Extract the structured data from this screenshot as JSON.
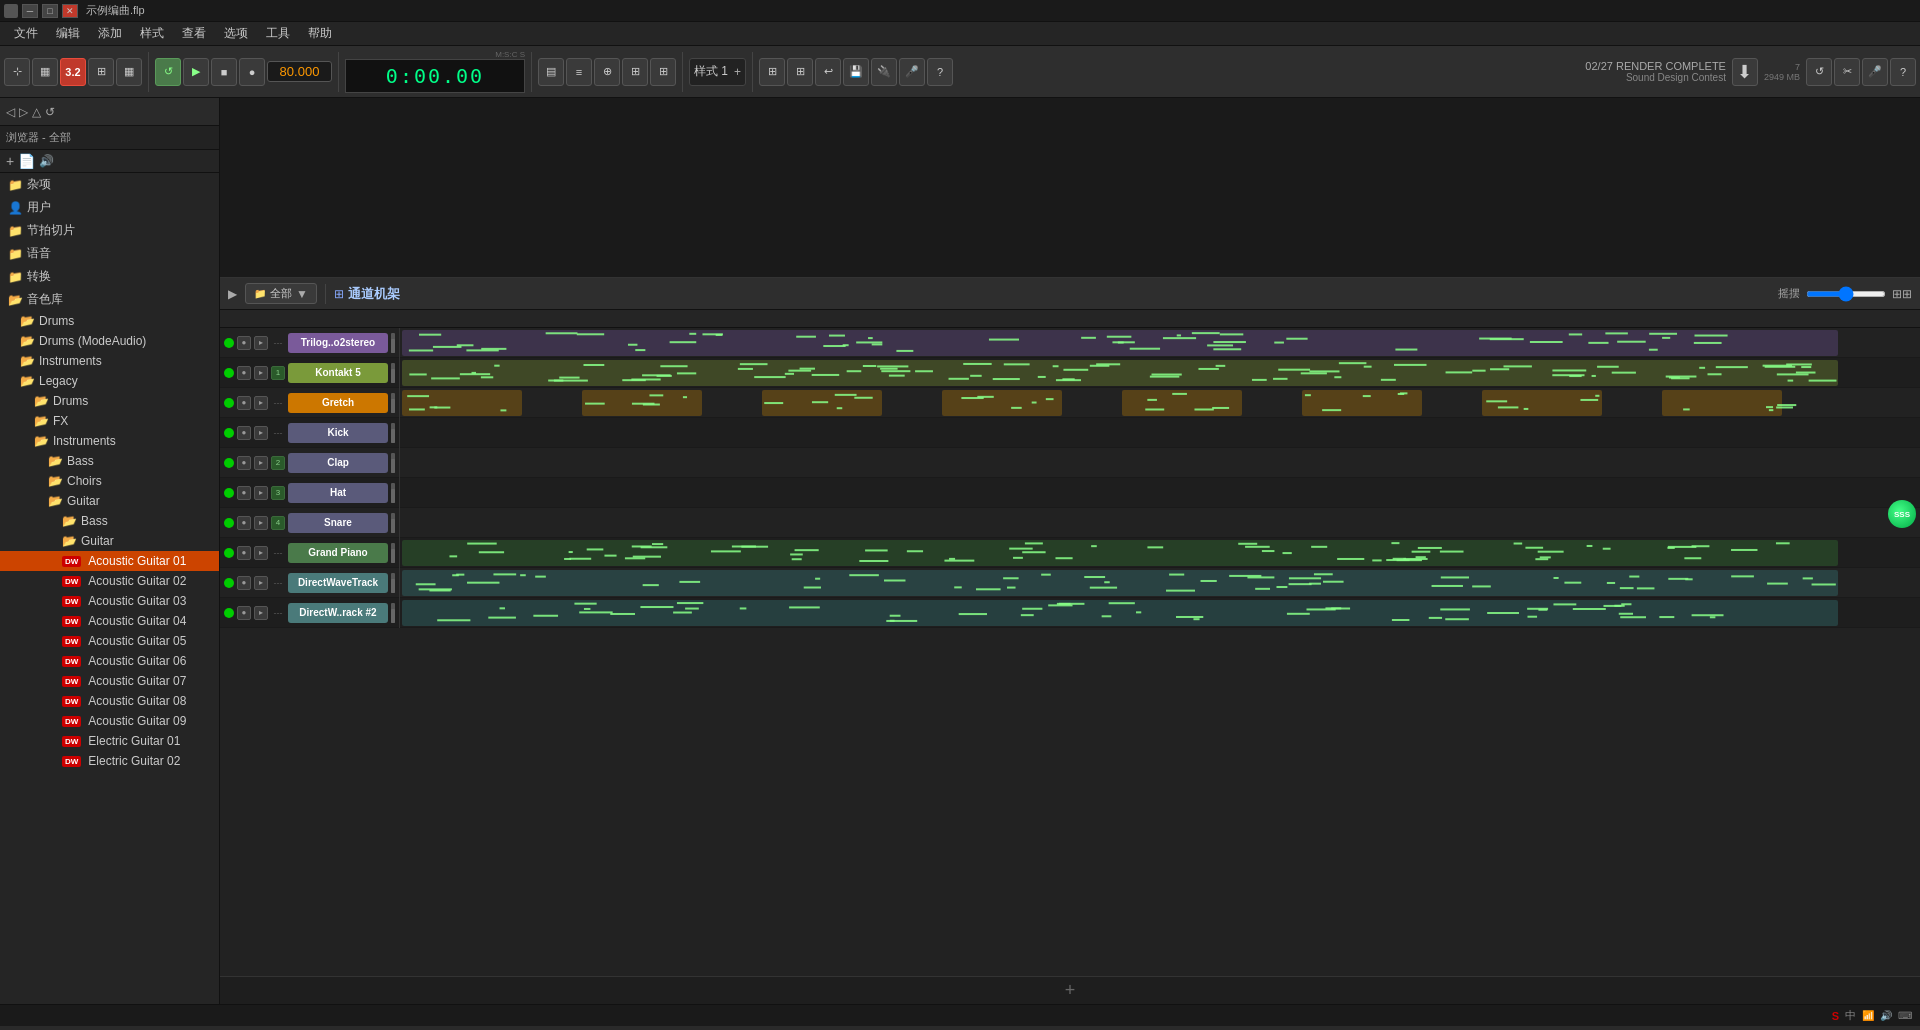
{
  "titlebar": {
    "icon": "●",
    "title": "示例编曲.flp",
    "minimize_label": "─",
    "maximize_label": "□",
    "close_label": "✕"
  },
  "menubar": {
    "items": [
      "文件",
      "编辑",
      "添加",
      "样式",
      "查看",
      "选项",
      "工具",
      "帮助"
    ]
  },
  "toolbar": {
    "bpm": "80.000",
    "time": "0:00.00",
    "time_label": "M:S:C S",
    "pattern_label": "样式 1",
    "render_status": "02/27 RENDER COMPLETE",
    "render_subtitle": "Sound Design Contest",
    "mem_label": "2949 MB",
    "mem_num": "7"
  },
  "sidebar": {
    "path_label": "浏览器 - 全部",
    "items": [
      {
        "id": "misc",
        "label": "杂项",
        "indent": 0,
        "icon": "folder",
        "type": "folder"
      },
      {
        "id": "user",
        "label": "用户",
        "indent": 0,
        "icon": "user",
        "type": "folder"
      },
      {
        "id": "beat-slice",
        "label": "节拍切片",
        "indent": 0,
        "icon": "folder",
        "type": "folder"
      },
      {
        "id": "voice",
        "label": "语音",
        "indent": 0,
        "icon": "folder",
        "type": "folder"
      },
      {
        "id": "convert",
        "label": "转换",
        "indent": 0,
        "icon": "folder",
        "type": "folder"
      },
      {
        "id": "soundfont",
        "label": "音色库",
        "indent": 0,
        "icon": "folder-open",
        "type": "folder",
        "expanded": true
      },
      {
        "id": "drums",
        "label": "Drums",
        "indent": 1,
        "icon": "folder-open",
        "type": "folder"
      },
      {
        "id": "drums-modeaudio",
        "label": "Drums (ModeAudio)",
        "indent": 1,
        "icon": "folder-open",
        "type": "folder"
      },
      {
        "id": "instruments",
        "label": "Instruments",
        "indent": 1,
        "icon": "folder-open",
        "type": "folder"
      },
      {
        "id": "legacy",
        "label": "Legacy",
        "indent": 1,
        "icon": "folder-open",
        "type": "folder",
        "expanded": true
      },
      {
        "id": "legacy-drums",
        "label": "Drums",
        "indent": 2,
        "icon": "folder-open",
        "type": "folder"
      },
      {
        "id": "legacy-fx",
        "label": "FX",
        "indent": 2,
        "icon": "folder-open",
        "type": "folder"
      },
      {
        "id": "legacy-instruments",
        "label": "Instruments",
        "indent": 2,
        "icon": "folder-open",
        "type": "folder",
        "expanded": true
      },
      {
        "id": "bass",
        "label": "Bass",
        "indent": 3,
        "icon": "folder-open",
        "type": "folder"
      },
      {
        "id": "choirs",
        "label": "Choirs",
        "indent": 3,
        "icon": "folder-open",
        "type": "folder"
      },
      {
        "id": "guitar-folder",
        "label": "Guitar",
        "indent": 3,
        "icon": "folder-open",
        "type": "folder",
        "expanded": true
      },
      {
        "id": "guitar-bass",
        "label": "Bass",
        "indent": 4,
        "icon": "folder-open",
        "type": "folder"
      },
      {
        "id": "guitar-guitar",
        "label": "Guitar",
        "indent": 4,
        "icon": "folder-open",
        "type": "folder"
      },
      {
        "id": "acoustic-01",
        "label": "Acoustic Guitar 01",
        "indent": 4,
        "type": "file",
        "selected": true,
        "dw": true
      },
      {
        "id": "acoustic-02",
        "label": "Acoustic Guitar 02",
        "indent": 4,
        "type": "file",
        "dw": true
      },
      {
        "id": "acoustic-03",
        "label": "Acoustic Guitar 03",
        "indent": 4,
        "type": "file",
        "dw": true
      },
      {
        "id": "acoustic-04",
        "label": "Acoustic Guitar 04",
        "indent": 4,
        "type": "file",
        "dw": true
      },
      {
        "id": "acoustic-05",
        "label": "Acoustic Guitar 05",
        "indent": 4,
        "type": "file",
        "dw": true
      },
      {
        "id": "acoustic-06",
        "label": "Acoustic Guitar 06",
        "indent": 4,
        "type": "file",
        "dw": true
      },
      {
        "id": "acoustic-07",
        "label": "Acoustic Guitar 07",
        "indent": 4,
        "type": "file",
        "dw": true
      },
      {
        "id": "acoustic-08",
        "label": "Acoustic Guitar 08",
        "indent": 4,
        "type": "file",
        "dw": true
      },
      {
        "id": "acoustic-09",
        "label": "Acoustic Guitar 09",
        "indent": 4,
        "type": "file",
        "dw": true
      },
      {
        "id": "electric-01",
        "label": "Electric Guitar 01",
        "indent": 4,
        "type": "file",
        "dw": true
      },
      {
        "id": "electric-02",
        "label": "Electric Guitar 02",
        "indent": 4,
        "type": "file",
        "dw": true
      }
    ]
  },
  "playlist": {
    "title": "通道机架",
    "pattern_select": "全部",
    "pan_label": "摇摆",
    "tracks": [
      {
        "id": "trilog",
        "name": "Trilog..o2stereo",
        "color": "#7a5a9a",
        "num": null,
        "led": true
      },
      {
        "id": "kontakt",
        "name": "Kontakt 5",
        "color": "#7a9a3a",
        "num": "1",
        "led": true
      },
      {
        "id": "gretch",
        "name": "Gretch",
        "color": "#cc7700",
        "num": null,
        "led": true
      },
      {
        "id": "kick",
        "name": "Kick",
        "color": "#5a5a7a",
        "num": null,
        "led": true
      },
      {
        "id": "clap",
        "name": "Clap",
        "color": "#5a5a7a",
        "num": "2",
        "led": true
      },
      {
        "id": "hat",
        "name": "Hat",
        "color": "#5a5a7a",
        "num": "3",
        "led": true
      },
      {
        "id": "snare",
        "name": "Snare",
        "color": "#5a5a7a",
        "num": "4",
        "led": true
      },
      {
        "id": "grandpiano",
        "name": "Grand Piano",
        "color": "#4a7a4a",
        "num": null,
        "led": true
      },
      {
        "id": "directwave",
        "name": "DirectWaveTrack",
        "color": "#4a7a7a",
        "num": null,
        "led": true
      },
      {
        "id": "directwave2",
        "name": "DirectW..rack #2",
        "color": "#4a7a7a",
        "num": null,
        "led": true
      }
    ]
  },
  "statusbar": {
    "text": ""
  }
}
